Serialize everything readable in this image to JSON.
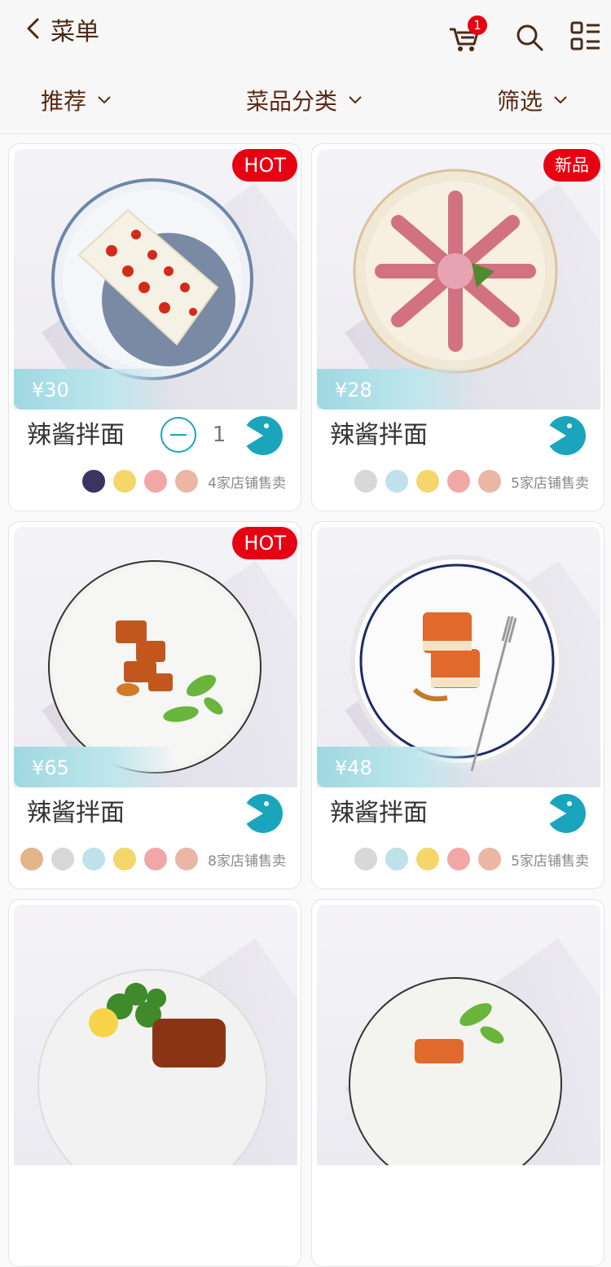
{
  "header": {
    "title": "菜单",
    "cart_badge": "1",
    "icons": [
      "back-icon",
      "cart-icon",
      "search-icon",
      "grid-menu-icon"
    ]
  },
  "filters": [
    {
      "label": "推荐"
    },
    {
      "label": "菜品分类"
    },
    {
      "label": "筛选"
    }
  ],
  "colors": {
    "accent": "#1aa5bd",
    "badge": "#e60012",
    "title": "#4a2a18"
  },
  "dishes": [
    {
      "name": "辣酱拌面",
      "price": "¥30",
      "tag": "HOT",
      "qty": "1",
      "shops_text": "4家店铺售卖"
    },
    {
      "name": "辣酱拌面",
      "price": "¥28",
      "tag": "新品",
      "shops_text": "5家店铺售卖"
    },
    {
      "name": "辣酱拌面",
      "price": "¥65",
      "tag": "HOT",
      "shops_text": "8家店铺售卖"
    },
    {
      "name": "辣酱拌面",
      "price": "¥48",
      "tag": "",
      "shops_text": "5家店铺售卖"
    },
    {
      "name": "",
      "price": "",
      "tag": "",
      "shops_text": ""
    },
    {
      "name": "",
      "price": "",
      "tag": "",
      "shops_text": ""
    }
  ]
}
